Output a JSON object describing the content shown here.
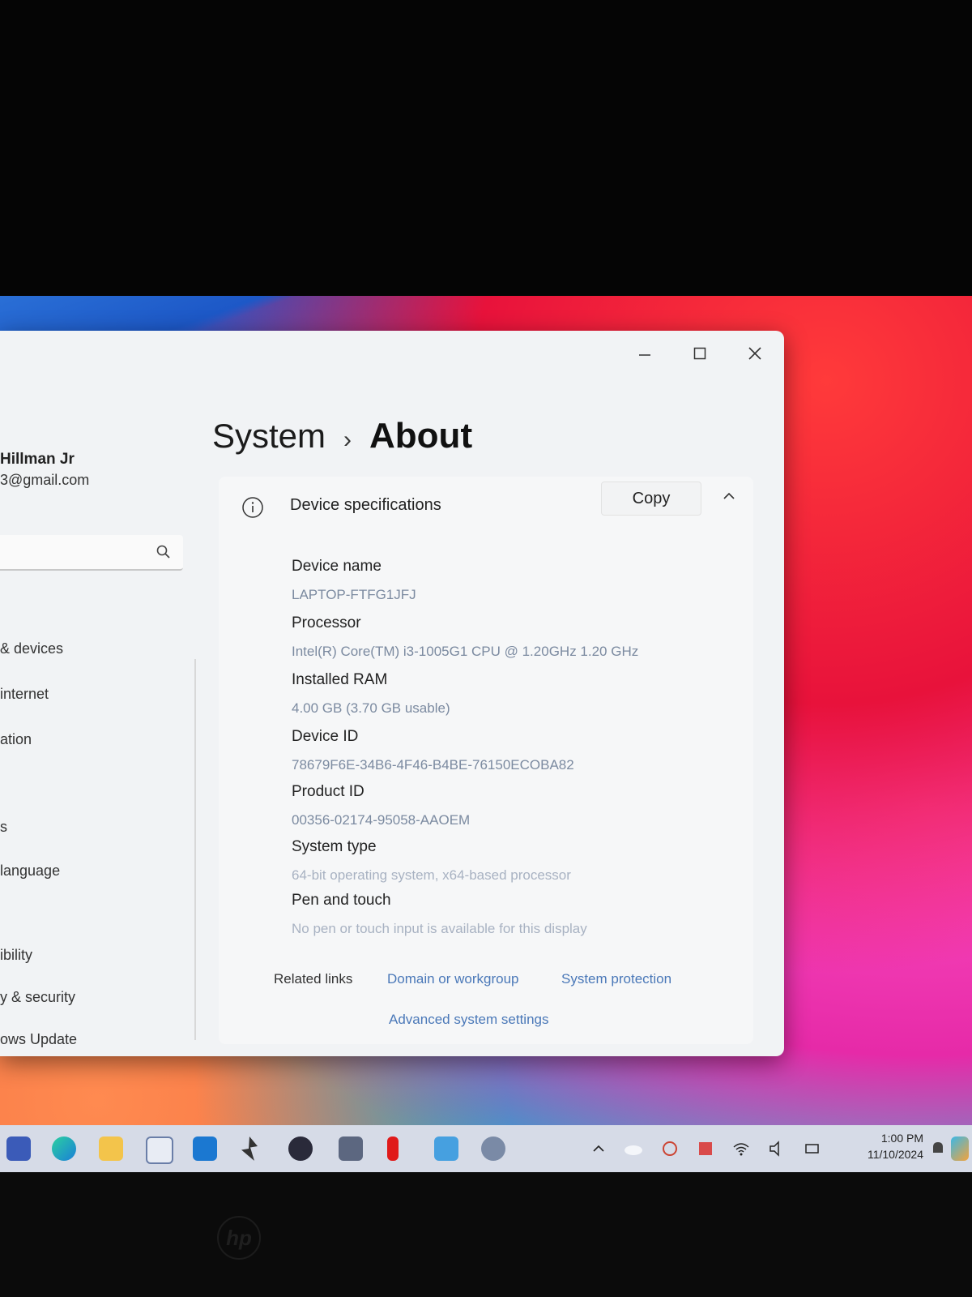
{
  "window": {
    "minimize_icon": "minimize-icon",
    "maximize_icon": "maximize-icon",
    "close_icon": "close-icon"
  },
  "profile": {
    "name": "Hillman Jr",
    "email": "3@gmail.com"
  },
  "search": {
    "placeholder": "",
    "icon": "search-icon"
  },
  "sidebar": {
    "items": [
      {
        "label": "& devices"
      },
      {
        "label": "internet"
      },
      {
        "label": "ation"
      },
      {
        "label": "s"
      },
      {
        "label": "language"
      },
      {
        "label": ""
      },
      {
        "label": "ibility"
      },
      {
        "label": "y & security"
      },
      {
        "label": "ows Update"
      }
    ]
  },
  "breadcrumb": {
    "root": "System",
    "separator": "›",
    "current": "About"
  },
  "device_specs": {
    "title": "Device specifications",
    "copy_label": "Copy",
    "rows": [
      {
        "label": "Device name",
        "value": "LAPTOP-FTFG1JFJ"
      },
      {
        "label": "Processor",
        "value": "Intel(R) Core(TM) i3-1005G1 CPU @ 1.20GHz   1.20 GHz"
      },
      {
        "label": "Installed RAM",
        "value": "4.00 GB (3.70 GB usable)"
      },
      {
        "label": "Device ID",
        "value": "78679F6E-34B6-4F46-B4BE-76150ECOBA82"
      },
      {
        "label": "Product ID",
        "value": "00356-02174-95058-AAOEM"
      },
      {
        "label": "System type",
        "value": "64-bit operating system, x64-based processor"
      },
      {
        "label": "Pen and touch",
        "value": "No pen or touch input is available for this display"
      }
    ]
  },
  "related_links": {
    "label": "Related links",
    "links": [
      "Domain or workgroup",
      "System protection",
      "Advanced system settings"
    ]
  },
  "taskbar": {
    "time": "1:00 PM",
    "date": "11/10/2024"
  },
  "colors": {
    "accent_link": "#4a78b8",
    "window_bg": "#f1f3f5",
    "taskbar_bg": "#d6dbe7"
  }
}
